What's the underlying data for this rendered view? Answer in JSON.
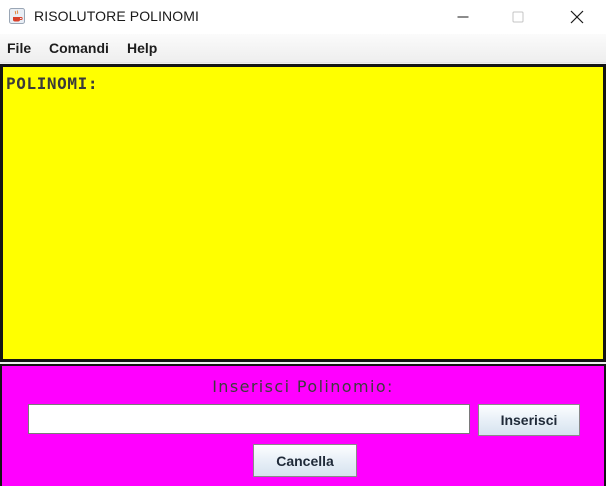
{
  "window": {
    "title": "RISOLUTORE POLINOMI",
    "icon": "java-cup-icon"
  },
  "menubar": {
    "items": [
      {
        "label": "File"
      },
      {
        "label": "Comandi"
      },
      {
        "label": "Help"
      }
    ]
  },
  "polynomials_panel": {
    "title": "POLINOMI:",
    "background": "#ffff00"
  },
  "input_panel": {
    "label": "Inserisci Polinomio:",
    "input_value": "",
    "insert_button": "Inserisci",
    "cancel_button": "Cancella",
    "background": "#ff00ff"
  }
}
